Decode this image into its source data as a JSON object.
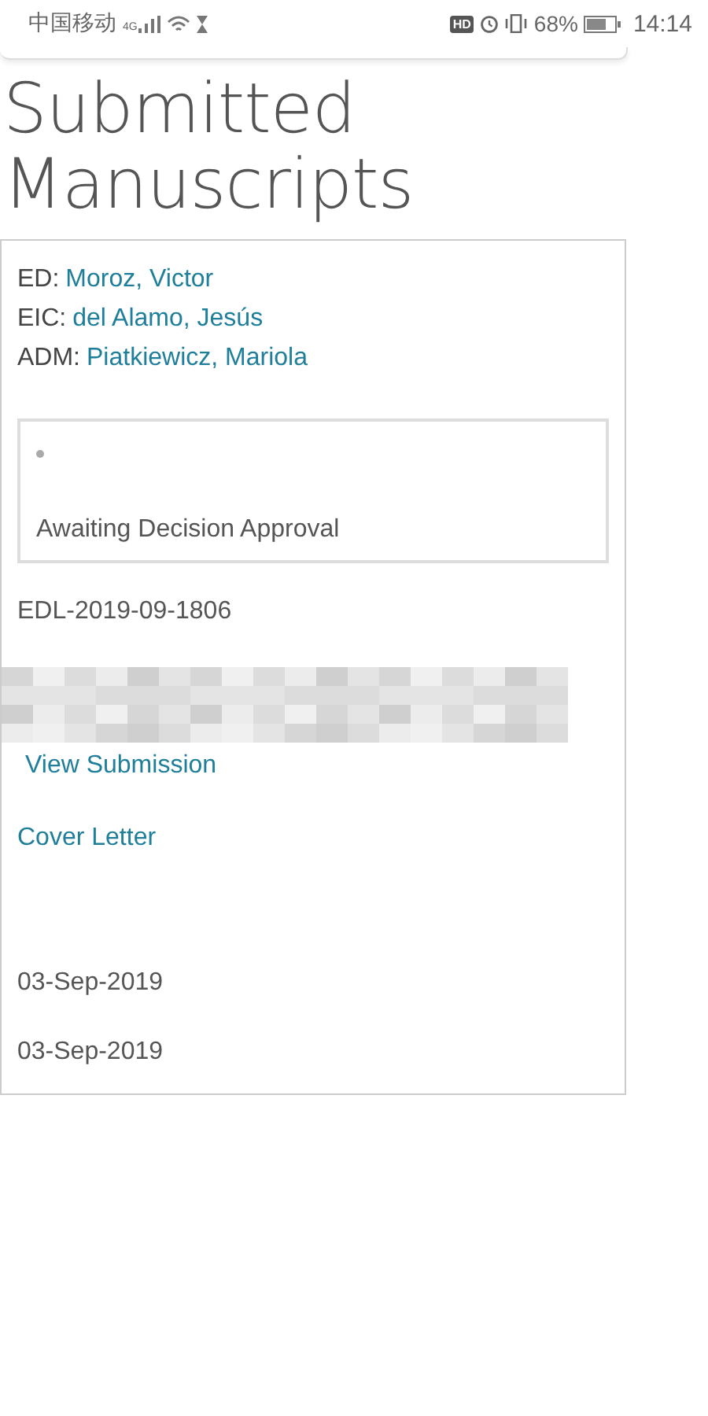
{
  "status_bar": {
    "carrier": "中国移动",
    "network": "4G",
    "hd": "HD",
    "battery": "68%",
    "time": "14:14"
  },
  "title": "Submitted Manuscripts",
  "manuscript": {
    "people": [
      {
        "role": "ED:",
        "name": "Moroz, Victor"
      },
      {
        "role": "EIC:",
        "name": "del Alamo, Jesús"
      },
      {
        "role": "ADM:",
        "name": "Piatkiewicz, Mariola"
      }
    ],
    "status": "Awaiting Decision Approval",
    "id": "EDL-2019-09-1806",
    "view_link": "View Submission",
    "cover_link": "Cover Letter",
    "dates": [
      "03-Sep-2019",
      "03-Sep-2019"
    ]
  }
}
